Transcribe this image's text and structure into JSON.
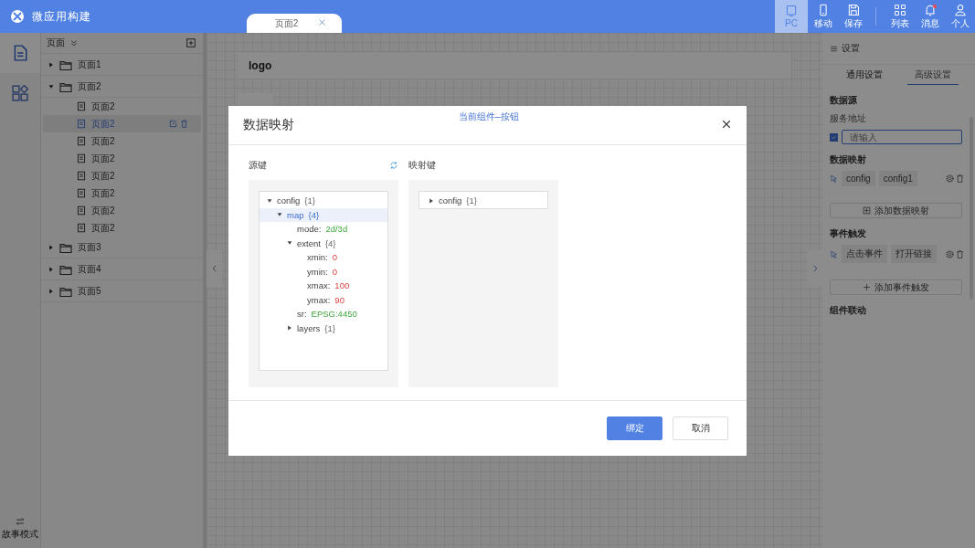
{
  "app": {
    "title": "微应用构建"
  },
  "tabs": [
    {
      "label": "页面2",
      "selected": true
    }
  ],
  "toolbar": [
    {
      "kind": "pc",
      "label": "PC",
      "selected": true,
      "badge": false
    },
    {
      "kind": "mobile",
      "label": "移动",
      "selected": false,
      "badge": false
    },
    {
      "kind": "save",
      "label": "保存",
      "selected": false,
      "badge": false
    },
    {
      "kind": "grid",
      "label": "列表",
      "selected": false,
      "badge": false
    },
    {
      "kind": "bell",
      "label": "消息",
      "selected": false,
      "badge": true
    },
    {
      "kind": "user",
      "label": "个人",
      "selected": false,
      "badge": false
    }
  ],
  "rail": {
    "items": [
      {
        "kind": "page",
        "selected": true
      },
      {
        "kind": "components",
        "selected": false
      }
    ],
    "footer": "故事模式"
  },
  "page_tree": {
    "title": "页面",
    "items": [
      {
        "label": "页面1",
        "expanded": false
      },
      {
        "label": "页面2",
        "expanded": true,
        "children": [
          {
            "label": "页面2",
            "selected": false
          },
          {
            "label": "页面2",
            "selected": true
          },
          {
            "label": "页面2",
            "selected": false
          },
          {
            "label": "页面2",
            "selected": false
          },
          {
            "label": "页面2",
            "selected": false
          },
          {
            "label": "页面2",
            "selected": false
          },
          {
            "label": "页面2",
            "selected": false
          },
          {
            "label": "页面2",
            "selected": false
          }
        ]
      },
      {
        "label": "页面3",
        "expanded": false
      },
      {
        "label": "页面4",
        "expanded": false
      },
      {
        "label": "页面5",
        "expanded": false
      }
    ]
  },
  "canvas": {
    "logo": "logo"
  },
  "settings": {
    "title": "设置",
    "tabs": [
      {
        "label": "通用设置",
        "selected": false
      },
      {
        "label": "高级设置",
        "selected": true
      }
    ],
    "data_source": {
      "title": "数据源",
      "field_label": "服务地址",
      "checked": true,
      "placeholder": "请输入"
    },
    "data_mapping": {
      "title": "数据映射",
      "chips": [
        "config",
        "config1"
      ],
      "add": "添加数据映射"
    },
    "events": {
      "title": "事件触发",
      "chips": [
        "点击事件",
        "打开链接"
      ],
      "add": "添加事件触发"
    },
    "linkage": {
      "title": "组件联动"
    }
  },
  "dialog": {
    "subtitle": "当前组件–按钮",
    "title": "数据映射",
    "source_label": "源键",
    "target_label": "映射键",
    "source_tree": [
      {
        "key": "config",
        "count": "{1}",
        "kind": "object",
        "expanded": true,
        "selected": false,
        "children": [
          {
            "key": "map",
            "count": "{4}",
            "kind": "object",
            "expanded": true,
            "selected": true,
            "children": [
              {
                "key": "mode:",
                "value": "2d/3d",
                "kind": "string"
              },
              {
                "key": "extent",
                "count": "{4}",
                "kind": "object",
                "expanded": true,
                "selected": false,
                "children": [
                  {
                    "key": "xmin:",
                    "value": "0",
                    "kind": "number"
                  },
                  {
                    "key": "ymin:",
                    "value": "0",
                    "kind": "number"
                  },
                  {
                    "key": "xmax:",
                    "value": "100",
                    "kind": "number"
                  },
                  {
                    "key": "ymax:",
                    "value": "90",
                    "kind": "number"
                  }
                ]
              },
              {
                "key": "sr:",
                "value": "EPSG:4450",
                "kind": "string"
              },
              {
                "key": "layers",
                "count": "{1}",
                "kind": "object",
                "expanded": false,
                "selected": false
              }
            ]
          }
        ]
      }
    ],
    "target_tree": [
      {
        "key": "config",
        "count": "{1}",
        "expanded": false,
        "selected": false
      }
    ],
    "buttons": [
      {
        "label": "绑定",
        "kind": "primary"
      },
      {
        "label": "取消",
        "kind": "default"
      }
    ]
  }
}
